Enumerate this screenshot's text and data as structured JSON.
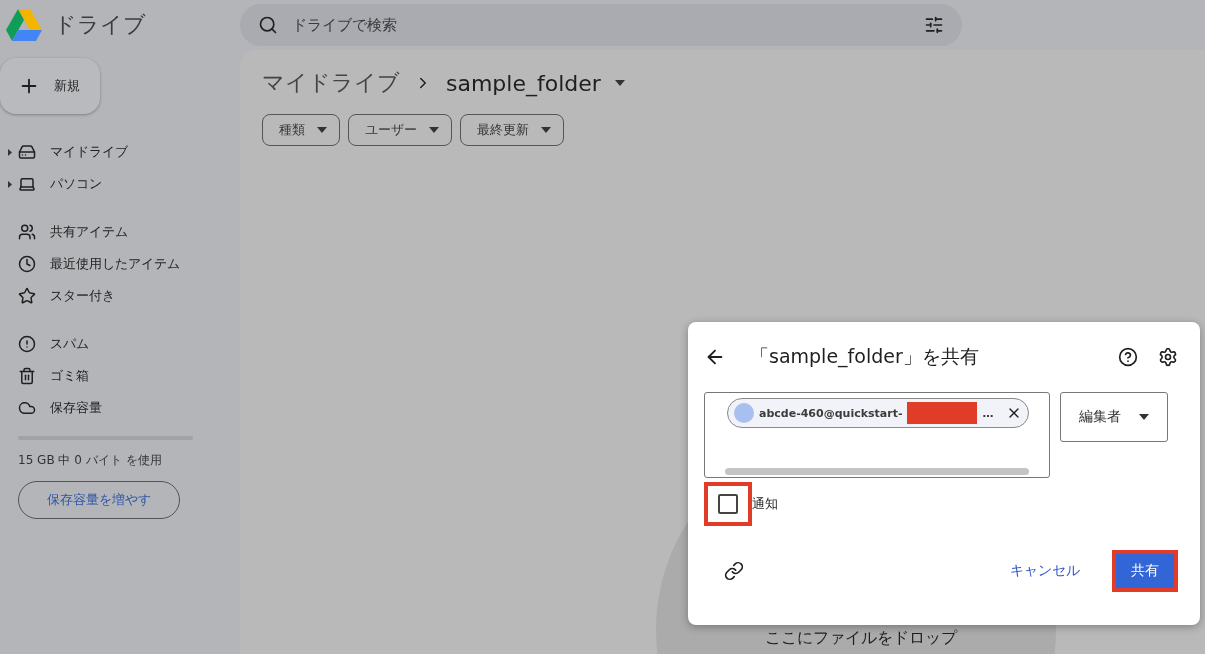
{
  "app": {
    "title": "ドライブ"
  },
  "search": {
    "placeholder": "ドライブで検索"
  },
  "new_button": {
    "label": "新規"
  },
  "sidebar": {
    "groups": [
      [
        {
          "label": "マイドライブ",
          "expandable": true
        },
        {
          "label": "パソコン",
          "expandable": true
        }
      ],
      [
        {
          "label": "共有アイテム",
          "expandable": false
        },
        {
          "label": "最近使用したアイテム",
          "expandable": false
        },
        {
          "label": "スター付き",
          "expandable": false
        }
      ],
      [
        {
          "label": "スパム",
          "expandable": false
        },
        {
          "label": "ゴミ箱",
          "expandable": false
        },
        {
          "label": "保存容量",
          "expandable": false
        }
      ]
    ],
    "storage": {
      "level": 0,
      "usage": "15 GB 中 0 バイト を使用",
      "button": "保存容量を増やす"
    }
  },
  "breadcrumb": [
    {
      "label": "マイドライブ"
    },
    {
      "label": "sample_folder"
    }
  ],
  "filters": [
    {
      "label": "種類"
    },
    {
      "label": "ユーザー"
    },
    {
      "label": "最終更新"
    }
  ],
  "drop_zone": {
    "text": "ここにファイルをドロップ"
  },
  "dialog": {
    "title": "「sample_folder」を共有",
    "recipient": {
      "email": "abcde-460@quickstart-",
      "tail": "…",
      "redacted": true
    },
    "role": "編集者",
    "notify": {
      "label": "通知",
      "checked": false,
      "highlighted": true
    },
    "cancel": "キャンセル",
    "share": {
      "label": "共有",
      "highlighted": true
    }
  }
}
